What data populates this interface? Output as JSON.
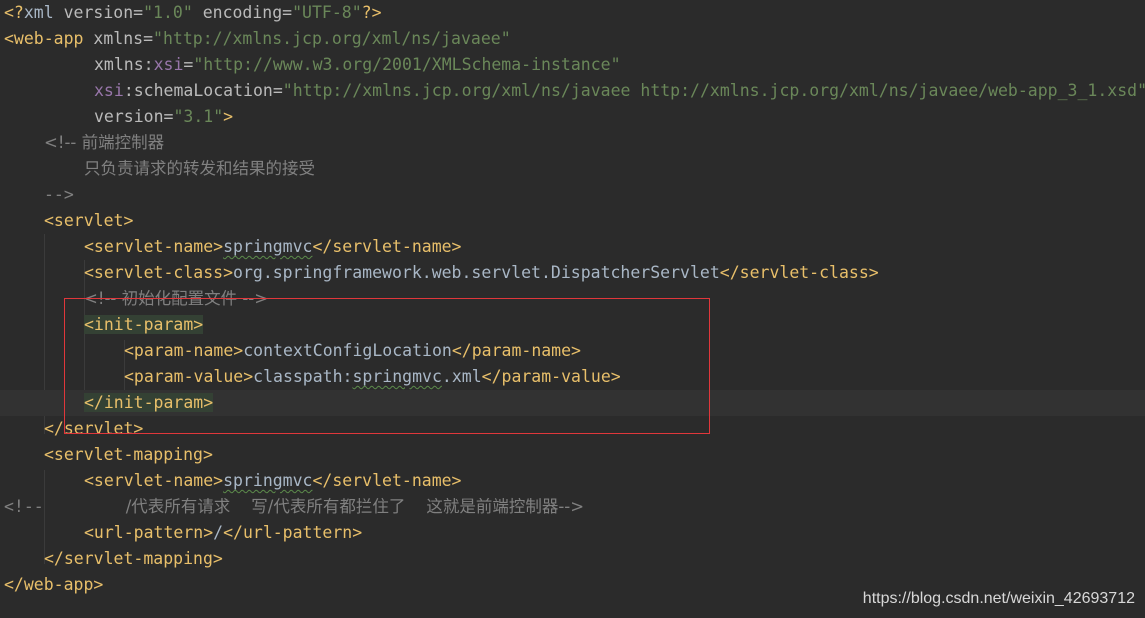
{
  "code": {
    "l1_pi_open": "<?",
    "l1_name": "xml",
    "l1_attr1": " version=",
    "l1_val1": "\"1.0\"",
    "l1_attr2": " encoding=",
    "l1_val2": "\"UTF-8\"",
    "l1_pi_close": "?>",
    "l2_tag": "<web-app",
    "l2_attr": " xmlns=",
    "l2_val": "\"http://xmlns.jcp.org/xml/ns/javaee\"",
    "l3_attr_a": "xmlns:",
    "l3_ns": "xsi",
    "l3_eq": "=",
    "l3_val": "\"http://www.w3.org/2001/XMLSchema-instance\"",
    "l4_ns": "xsi",
    "l4_attr": ":schemaLocation=",
    "l4_val": "\"http://xmlns.jcp.org/xml/ns/javaee http://xmlns.jcp.org/xml/ns/javaee/web-app_3_1.xsd\"",
    "l5_attr": "version=",
    "l5_val": "\"3.1\"",
    "l5_close": ">",
    "l6_comment": "<!-- 前端控制器",
    "l7_comment": "只负责请求的转发和结果的接受",
    "l8_comment": "-->",
    "l9_tag": "<servlet>",
    "l10_open": "<servlet-name>",
    "l10_text": "springmvc",
    "l10_close": "</servlet-name>",
    "l11_open": "<servlet-class>",
    "l11_text": "org.springframework.web.servlet.DispatcherServlet",
    "l11_close": "</servlet-class>",
    "l12_comment": "<!-- 初始化配置文件 -->",
    "l13_tag": "<init-param>",
    "l14_open": "<param-name>",
    "l14_text": "contextConfigLocation",
    "l14_close": "</param-name>",
    "l15_open": "<param-value>",
    "l15_text_a": "classpath:",
    "l15_text_b": "springmvc",
    "l15_text_c": ".xml",
    "l15_close": "</param-value>",
    "l16_tag": "</init-param>",
    "l17_tag": "</servlet>",
    "l18_tag": "<servlet-mapping>",
    "l19_open": "<servlet-name>",
    "l19_text": "springmvc",
    "l19_close": "</servlet-name>",
    "l20_comment_a": "<!--",
    "l20_comment_b": "/代表所有请求    写/代表所有都拦住了    这就是前端控制器-->",
    "l21_open": "<url-pattern>",
    "l21_text": "/",
    "l21_close": "</url-pattern>",
    "l22_tag": "</servlet-mapping>",
    "l23_tag": "</web-app>"
  },
  "watermark": "https://blog.csdn.net/weixin_42693712",
  "colors": {
    "background": "#2b2b2b",
    "tag": "#e8bf6a",
    "attribute": "#bababa",
    "string": "#6a8759",
    "namespace": "#9876aa",
    "comment": "#808080",
    "text": "#a9b7c6",
    "annotation_box": "#e0373b"
  }
}
